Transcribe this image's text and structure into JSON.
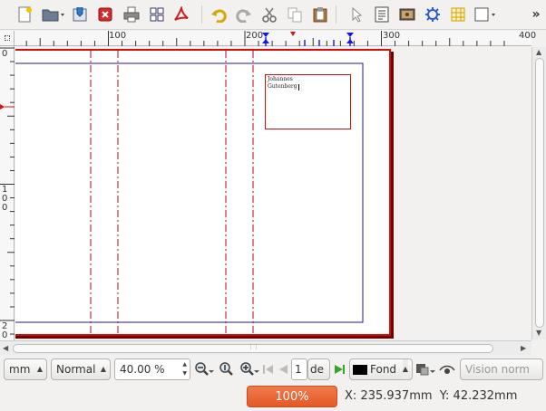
{
  "toolbar": {
    "icons": [
      "new-document-icon",
      "open-folder-icon",
      "save-icon",
      "close-document-icon",
      "print-icon",
      "preflight-icon",
      "export-pdf-icon",
      "undo-icon",
      "redo-icon",
      "cut-icon",
      "copy-icon",
      "paste-icon",
      "select-icon",
      "text-frame-icon",
      "image-frame-icon",
      "render-frame-icon",
      "table-icon",
      "shape-icon"
    ],
    "more_label": "»"
  },
  "ruler": {
    "h_labels": [
      "100",
      "200",
      "300",
      "400"
    ],
    "v_labels": [
      {
        "text": "0"
      },
      {
        "text": "1\n0\n0"
      },
      {
        "text": "2\n0"
      }
    ]
  },
  "document": {
    "text_lines": [
      "Johannes",
      "Gutenberg"
    ]
  },
  "bottombar": {
    "unit": "mm",
    "mode": "Normal",
    "zoom_value": "40.00 %",
    "page_number": "1",
    "page_of": "de",
    "layer": "Fond",
    "preview_mode": "Vision norm"
  },
  "status": {
    "zoom_button": "100%",
    "x_label": "X:",
    "x_value": "235.937mm",
    "y_label": "Y:",
    "y_value": "42.232mm"
  },
  "colors": {
    "page_border": "#d01010",
    "margin_guide": "#1a1aa0",
    "column_guide": "#c00020",
    "zoom_accent": "#e45a27"
  }
}
